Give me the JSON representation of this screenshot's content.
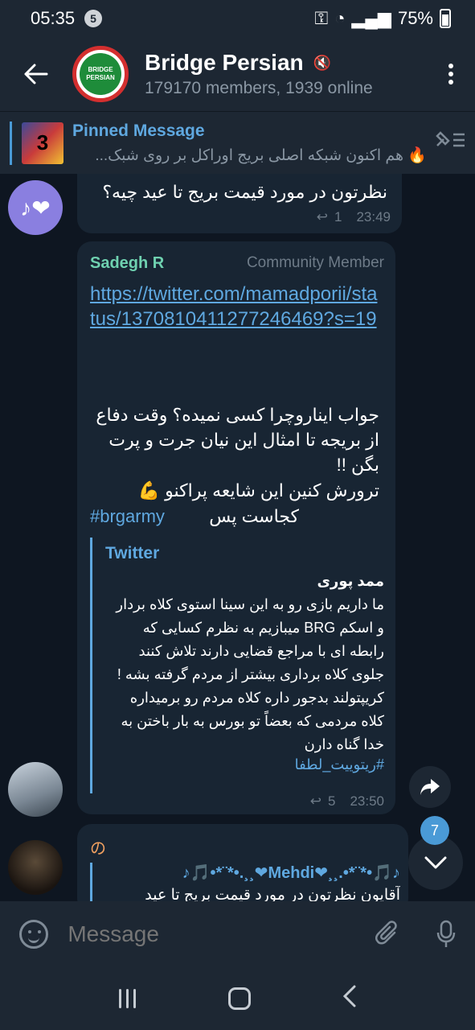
{
  "status": {
    "time": "05:35",
    "notif_count": "5",
    "battery": "75%"
  },
  "header": {
    "title": "Bridge Persian",
    "subtitle": "179170 members, 1939 online",
    "logo_text_1": "BRIDGE",
    "logo_text_2": "PERSIAN"
  },
  "pinned": {
    "label": "Pinned Message",
    "text": "🔥 هم اکنون شبکه اصلی بریج اوراکل بر روی شبک..."
  },
  "messages": [
    {
      "text": "نظرتون در مورد قیمت بریج تا عید چیه؟",
      "replies": "1",
      "time": "23:49",
      "avatar_glyph": "♪❤"
    },
    {
      "sender": "Sadegh R",
      "role": "Community Member",
      "link": "https://twitter.com/mamadporii/status/1370810411277246469?s=19",
      "line1": "جواب ایناروچرا کسی نمیده؟ وقت دفاع از بریجه تا امثال این نیان جرت و پرت بگن !!",
      "line2": "ترورش کنین این شایعه پراکنو 💪",
      "line3": "کجاست پس",
      "hashtag": "#brgarmy",
      "quote_title": "Twitter",
      "quote_author": "ممد پوری",
      "quote_text": "ما داریم بازی رو به این سینا استوی کلاه بردار و اسکم BRG میبازیم به نظرم کسایی که رابطه ای با مراجع قضایی دارند تلاش کنند جلوی کلاه برداری بیشتر از مردم گرفته بشه ! کریپتولند بدجور داره کلاه مردم رو برمیداره کلاه مردمی که بعضاً تو بورس به بار باختن به خدا گناه دارن",
      "quote_tag": "#ریتوییت_لطفا",
      "replies": "5",
      "time": "23:50"
    },
    {
      "sender": "の",
      "reply_name": "♪🎵•*¨*•.¸¸❤Mehdi❤¸¸.•*¨*•🎵♪",
      "reply_text": "آقایون نظرتون در مورد قیمت بریج تا عید"
    }
  ],
  "scroll_badge": "7",
  "input": {
    "placeholder": "Message"
  },
  "colors": {
    "bg": "#0e1621",
    "bubble": "#182533",
    "accent": "#5fa8e0",
    "panel": "#1d2733"
  }
}
